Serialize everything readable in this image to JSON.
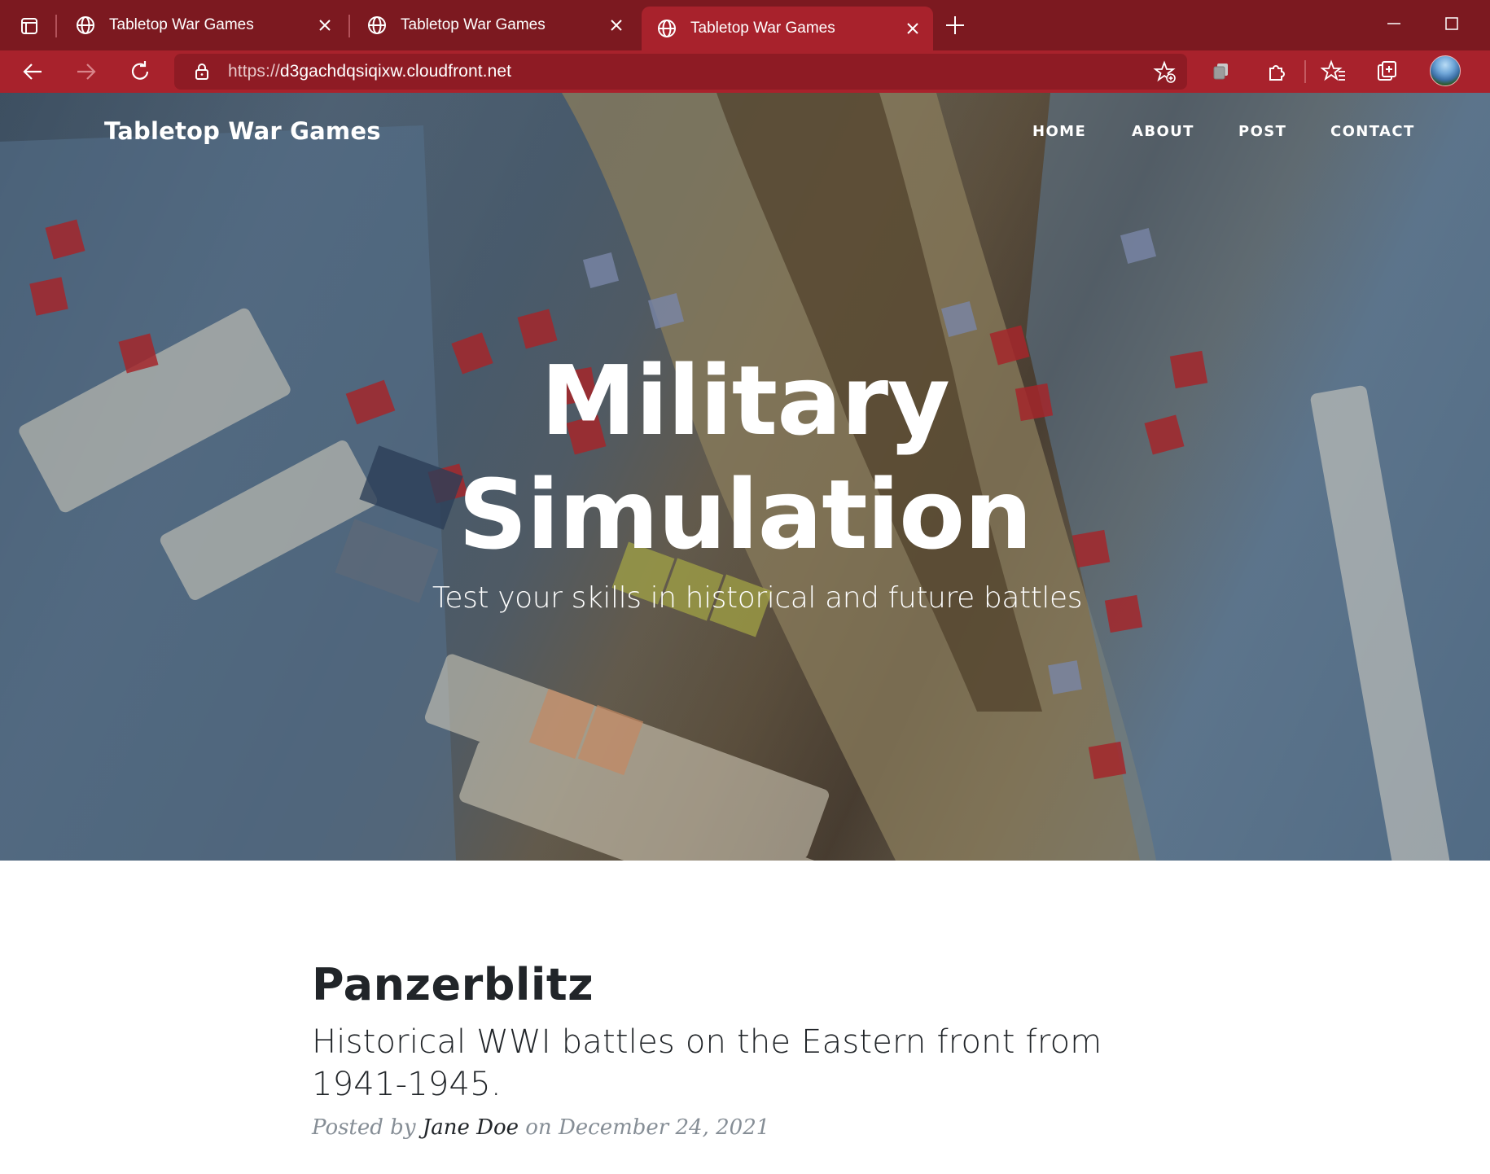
{
  "browser": {
    "tabs": [
      {
        "title": "Tabletop War Games",
        "active": false
      },
      {
        "title": "Tabletop War Games",
        "active": false
      },
      {
        "title": "Tabletop War Games",
        "active": true
      }
    ],
    "url_protocol": "https://",
    "url_host": "d3gachdqsiqixw.cloudfront.net",
    "colors": {
      "tabbar": "#7c1920",
      "toolbar": "#a8222c",
      "urlbox": "#8e1b24"
    },
    "icons": [
      "tab-actions-icon",
      "globe-icon",
      "close-icon",
      "plus-icon",
      "minimize-icon",
      "maximize-icon",
      "back-arrow-icon",
      "forward-arrow-icon",
      "refresh-icon",
      "lock-icon",
      "add-favorite-icon",
      "collections-icon",
      "extensions-icon",
      "favorites-icon",
      "browser-essentials-icon",
      "profile-avatar"
    ]
  },
  "site": {
    "brand": "Tabletop War Games",
    "nav": [
      "HOME",
      "ABOUT",
      "POST",
      "CONTACT"
    ]
  },
  "hero": {
    "title_line1": "Military",
    "title_line2": "Simulation",
    "subtitle": "Test your skills in historical and future battles"
  },
  "post": {
    "title": "Panzerblitz",
    "subtitle": "Historical WWI battles on the Eastern front from 1941-1945.",
    "posted_by": "Posted by",
    "author": "Jane Doe",
    "on": "on",
    "date": "December 24, 2021"
  }
}
